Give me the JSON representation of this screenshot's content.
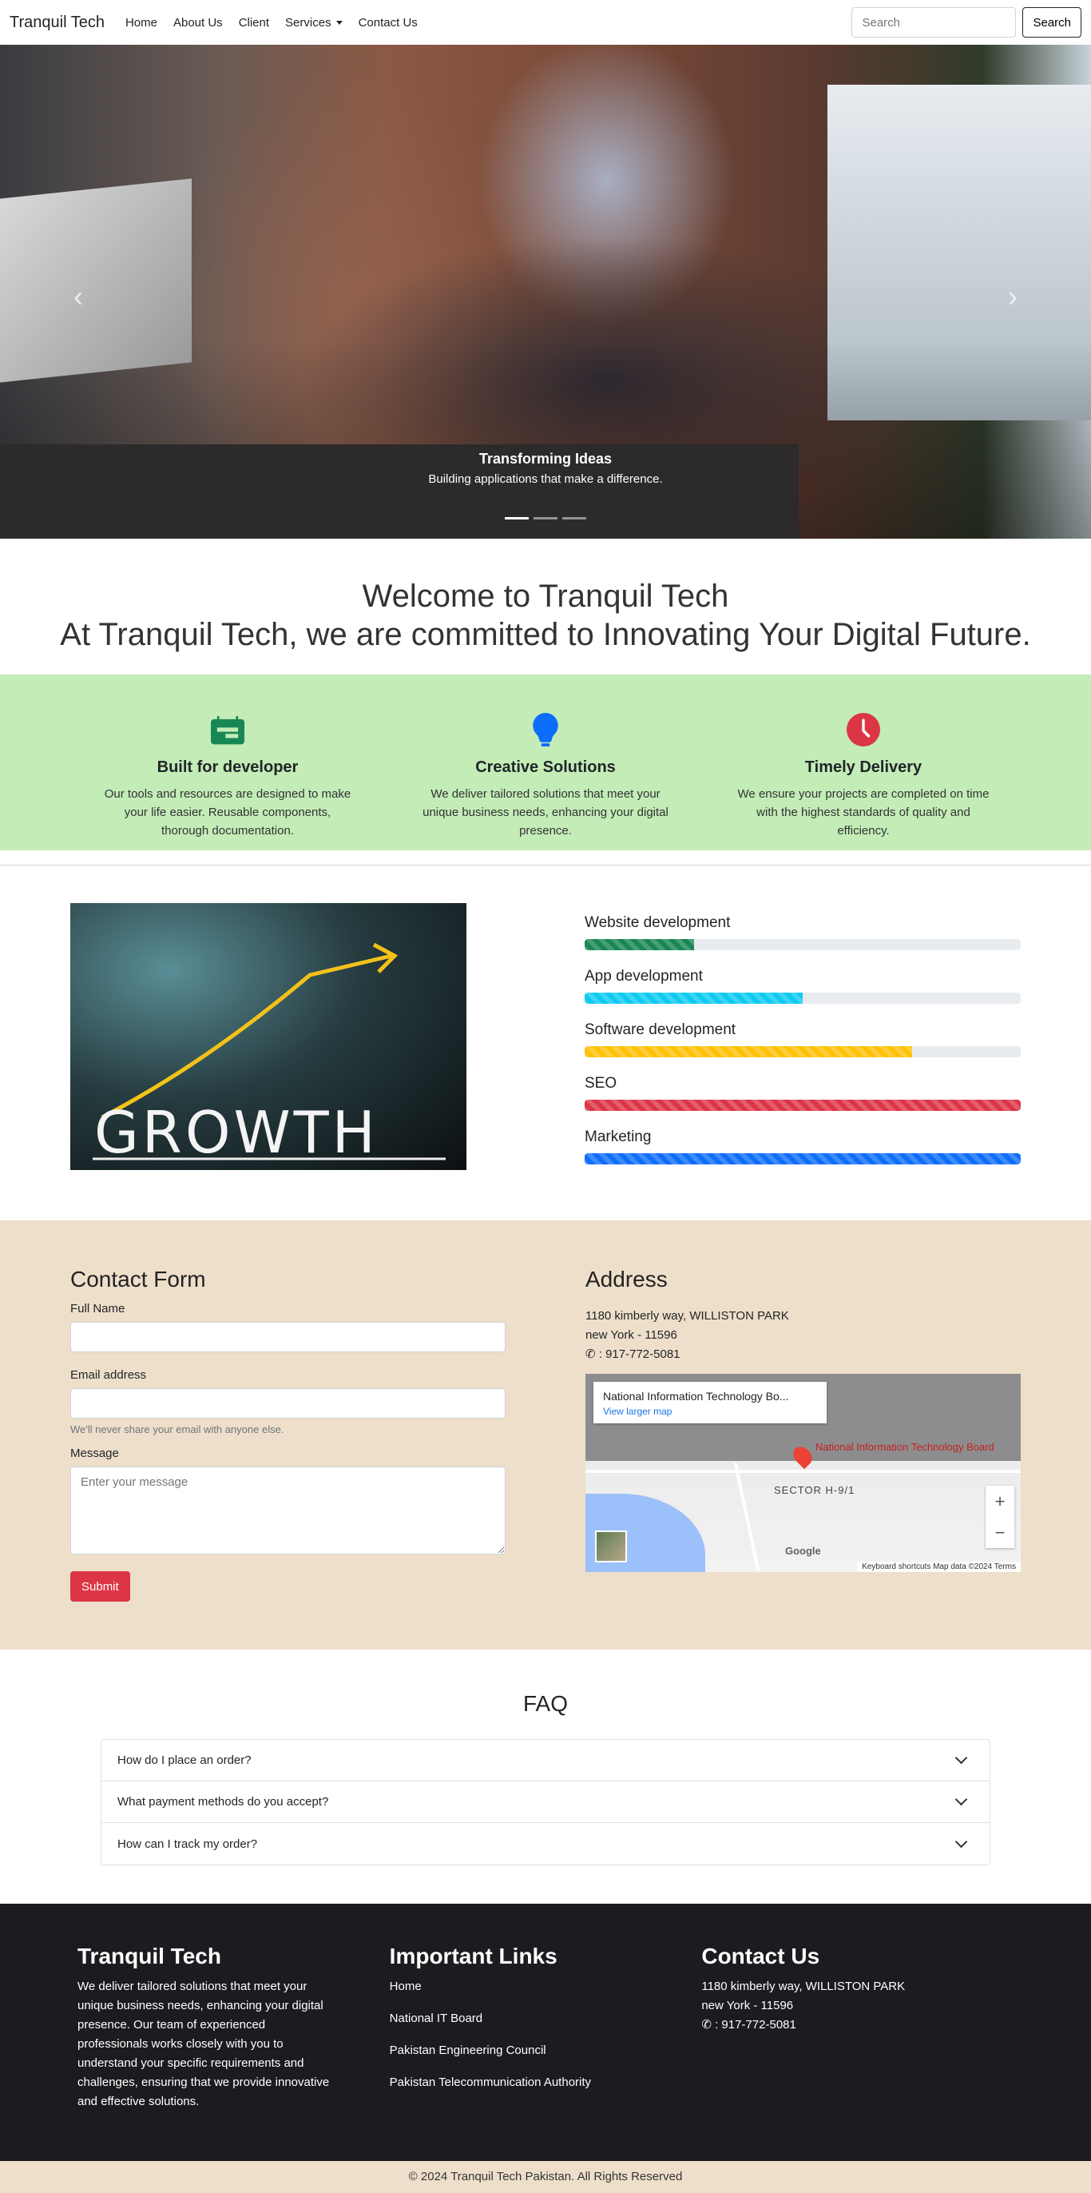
{
  "nav": {
    "brand": "Tranquil Tech",
    "links": [
      "Home",
      "About Us",
      "Client",
      "Services",
      "Contact Us"
    ],
    "search_placeholder": "Search",
    "search_button": "Search"
  },
  "hero": {
    "caption_title": "Transforming Ideas",
    "caption_text": "Building applications that make a difference.",
    "prev_icon": "‹",
    "next_icon": "›"
  },
  "welcome": {
    "line1": "Welcome to Tranquil Tech",
    "line2": "At Tranquil Tech, we are committed to Innovating Your Digital Future."
  },
  "features": [
    {
      "icon": "calendar-icon",
      "color": "#198754",
      "title": "Built for developer",
      "text": "Our tools and resources are designed to make your life easier. Reusable components, thorough documentation."
    },
    {
      "icon": "lightbulb-icon",
      "color": "#0d6efd",
      "title": "Creative Solutions",
      "text": "We deliver tailored solutions that meet your unique business needs, enhancing your digital presence."
    },
    {
      "icon": "clock-icon",
      "color": "#dc3545",
      "title": "Timely Delivery",
      "text": "We ensure your projects are completed on time with the highest standards of quality and efficiency."
    }
  ],
  "skills": [
    {
      "label": "Website development",
      "percent": 25,
      "color": "#198754"
    },
    {
      "label": "App development",
      "percent": 50,
      "color": "#0dcaf0"
    },
    {
      "label": "Software development",
      "percent": 75,
      "color": "#ffc107"
    },
    {
      "label": "SEO",
      "percent": 100,
      "color": "#dc3545"
    },
    {
      "label": "Marketing",
      "percent": 100,
      "color": "#0d6efd"
    }
  ],
  "contact": {
    "title": "Contact Form",
    "name_label": "Full Name",
    "email_label": "Email address",
    "email_help": "We'll never share your email with anyone else.",
    "message_label": "Message",
    "message_placeholder": "Enter your message",
    "submit": "Submit"
  },
  "address": {
    "title": "Address",
    "line1": "1180 kimberly way, WILLISTON PARK",
    "line2": "new York - 11596",
    "phone": ": 917-772-5081",
    "map_place": "National Information Technology Bo...",
    "map_link": "View larger map",
    "map_label": "National Information Technology Board",
    "map_sector": "SECTOR H-9/1",
    "map_footer": "Keyboard shortcuts   Map data ©2024   Terms"
  },
  "faq": {
    "title": "FAQ",
    "items": [
      "How do I place an order?",
      "What payment methods do you accept?",
      "How can I track my order?"
    ]
  },
  "footer": {
    "about_title": "Tranquil Tech",
    "about_text": "We deliver tailored solutions that meet your unique business needs, enhancing your digital presence. Our team of experienced professionals works closely with you to understand your specific requirements and challenges, ensuring that we provide innovative and effective solutions.",
    "links_title": "Important Links",
    "links": [
      "Home",
      "National IT Board",
      "Pakistan Engineering Council",
      "Pakistan Telecommunication Authority"
    ],
    "contact_title": "Contact Us",
    "contact_line1": "1180 kimberly way, WILLISTON PARK",
    "contact_line2": "new York - 11596",
    "contact_phone": ": 917-772-5081",
    "copyright": "© 2024 Tranquil Tech Pakistan. All Rights Reserved"
  }
}
